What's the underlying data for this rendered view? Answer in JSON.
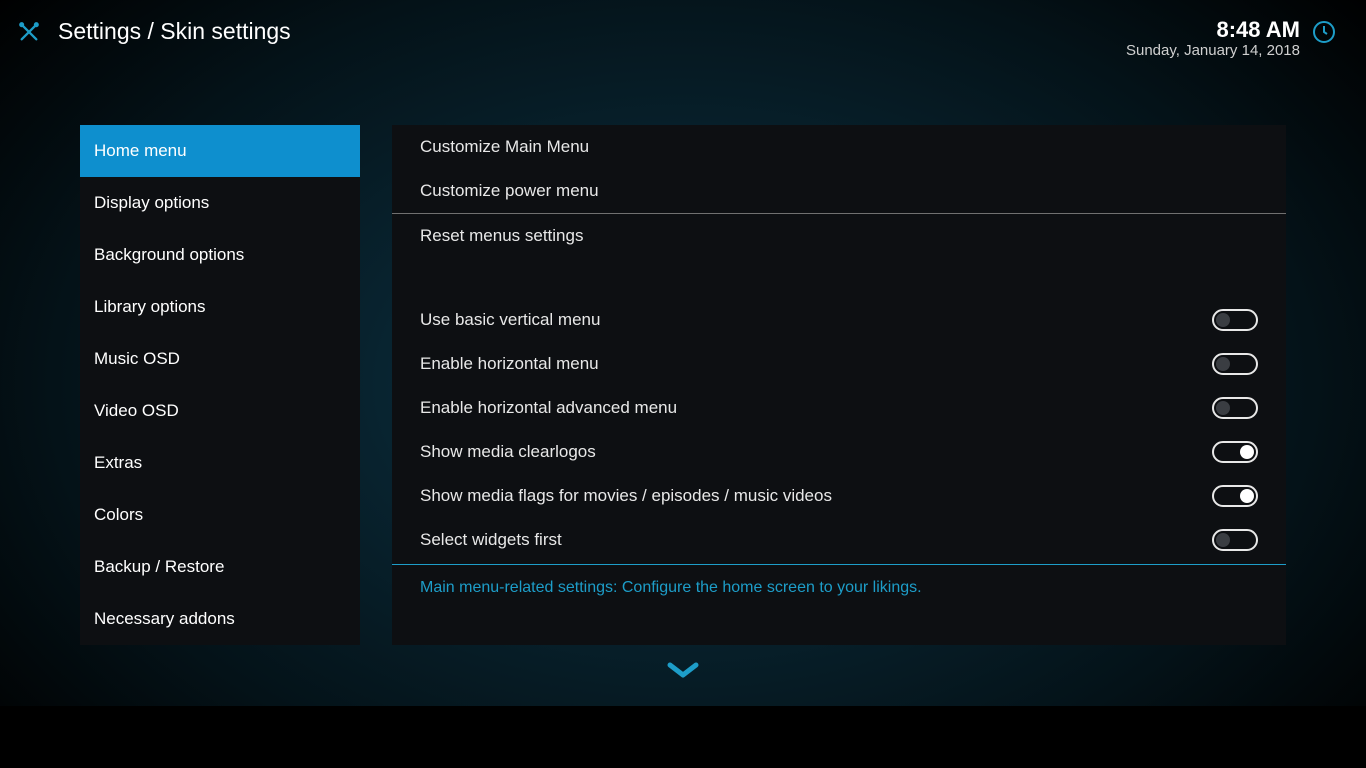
{
  "header": {
    "breadcrumb": "Settings / Skin settings",
    "time": "8:48 AM",
    "date": "Sunday, January 14, 2018"
  },
  "sidebar": {
    "items": [
      {
        "label": "Home menu",
        "active": true
      },
      {
        "label": "Display options",
        "active": false
      },
      {
        "label": "Background options",
        "active": false
      },
      {
        "label": "Library options",
        "active": false
      },
      {
        "label": "Music OSD",
        "active": false
      },
      {
        "label": "Video OSD",
        "active": false
      },
      {
        "label": "Extras",
        "active": false
      },
      {
        "label": "Colors",
        "active": false
      },
      {
        "label": "Backup / Restore",
        "active": false
      },
      {
        "label": "Necessary addons",
        "active": false
      }
    ]
  },
  "main": {
    "actions": [
      {
        "label": "Customize Main Menu"
      },
      {
        "label": "Customize power menu"
      },
      {
        "label": "Reset menus settings"
      }
    ],
    "toggles": [
      {
        "label": "Use basic vertical menu",
        "on": false
      },
      {
        "label": "Enable horizontal menu",
        "on": false
      },
      {
        "label": "Enable horizontal advanced menu",
        "on": false
      },
      {
        "label": "Show media clearlogos",
        "on": true
      },
      {
        "label": "Show media flags for movies / episodes / music videos",
        "on": true
      },
      {
        "label": "Select widgets first",
        "on": false
      }
    ],
    "description": "Main menu-related settings: Configure the home screen to your likings."
  }
}
